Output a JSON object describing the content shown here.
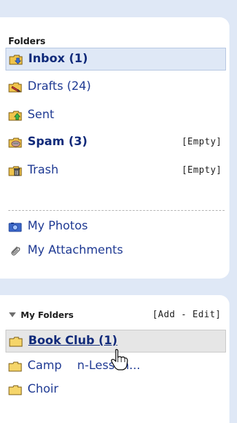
{
  "folders": {
    "header": "Folders",
    "items": [
      {
        "label": "Inbox (1)",
        "icon": "inbox-icon"
      },
      {
        "label": "Drafts (24)",
        "icon": "drafts-icon"
      },
      {
        "label": "Sent",
        "icon": "sent-icon"
      },
      {
        "label": "Spam (3)",
        "icon": "spam-icon",
        "action": "[Empty]"
      },
      {
        "label": "Trash",
        "icon": "trash-icon",
        "action": "[Empty]"
      }
    ]
  },
  "extras": [
    {
      "label": "My Photos",
      "icon": "photos-icon"
    },
    {
      "label": "My Attachments",
      "icon": "paperclip-icon"
    }
  ],
  "my_folders": {
    "header": "My Folders",
    "actions": "[Add - Edit]",
    "items": [
      {
        "label": "Book Club (1)",
        "icon": "folder-icon"
      },
      {
        "label": "Camp​  n-Lesson...",
        "icon": "folder-icon"
      },
      {
        "label": "Choir",
        "icon": "folder-icon"
      }
    ]
  },
  "colors": {
    "background": "#dfe8f6",
    "selected_row": "#dfe8f6",
    "hover_row": "#e6e6e6",
    "link": "#1f3a93"
  }
}
